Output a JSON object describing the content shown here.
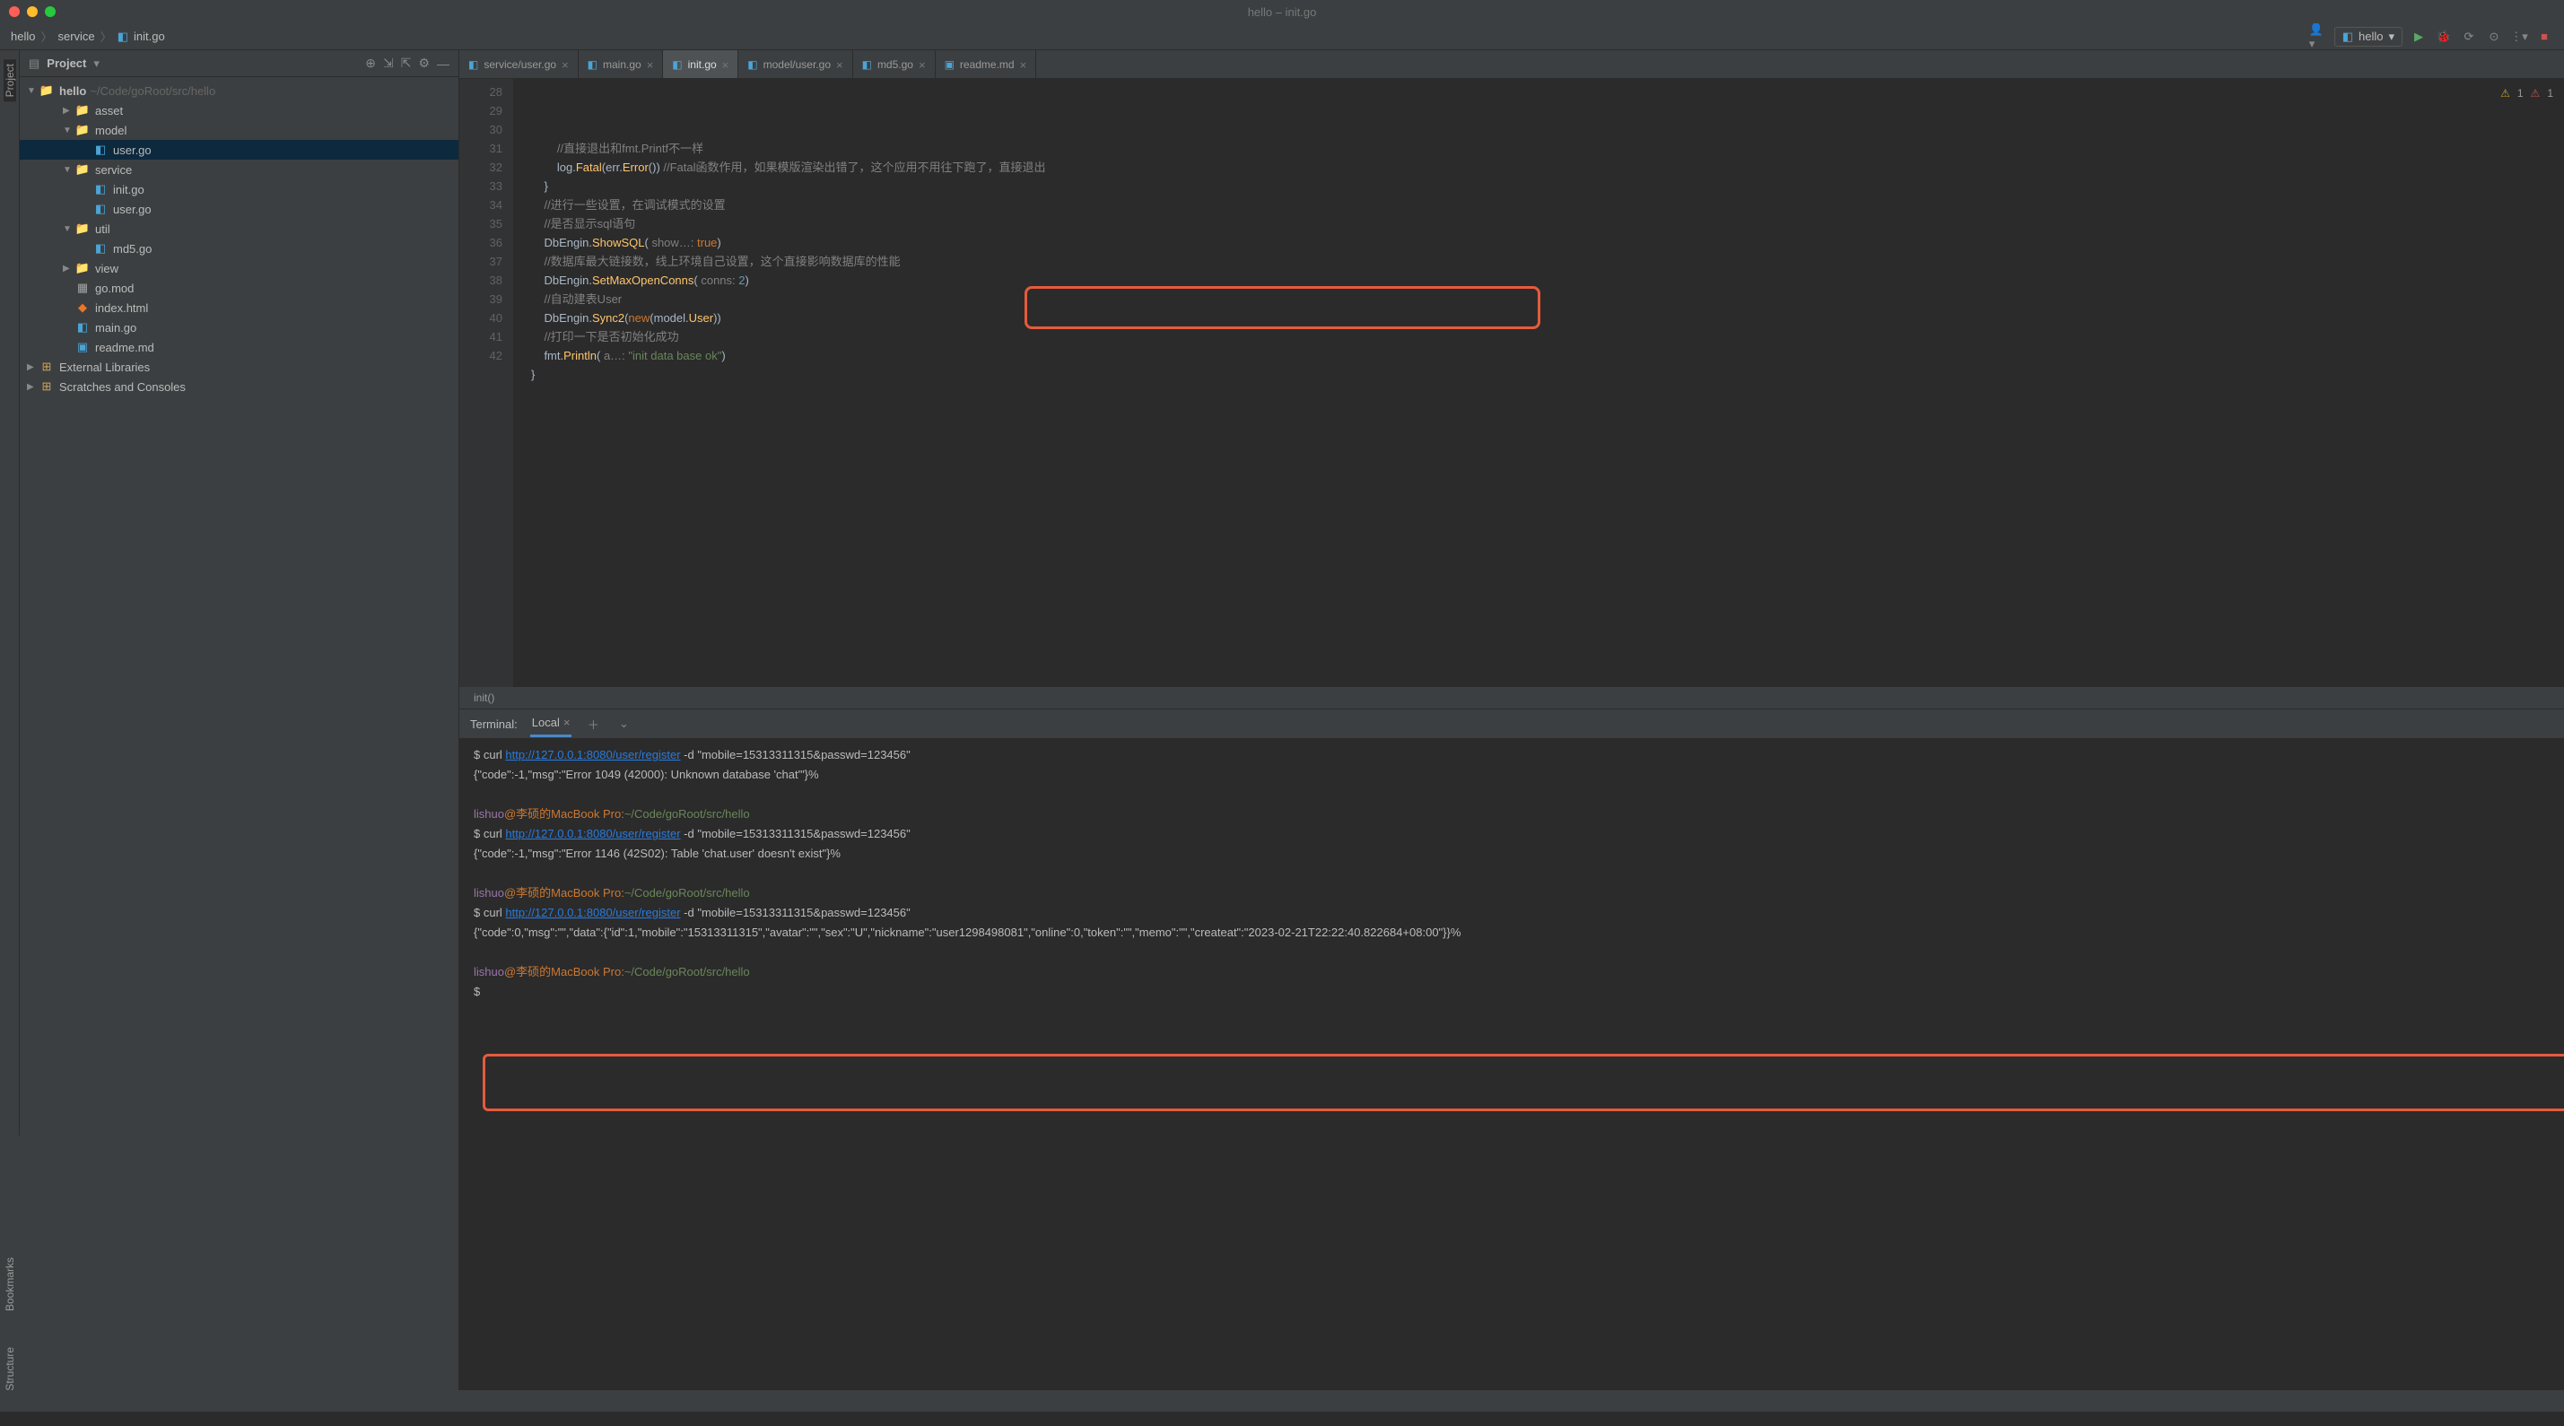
{
  "window_title": "hello – init.go",
  "breadcrumbs": [
    "hello",
    "service",
    "init.go"
  ],
  "run_config": "hello",
  "warnings": {
    "yellow": "1",
    "red": "1"
  },
  "project_header": "Project",
  "tree": {
    "root": {
      "name": "hello",
      "path": "~/Code/goRoot/src/hello"
    },
    "items": [
      {
        "name": "asset",
        "type": "folder",
        "indent": 2,
        "expand": "▶"
      },
      {
        "name": "model",
        "type": "folder",
        "indent": 2,
        "expand": "▼"
      },
      {
        "name": "user.go",
        "type": "go",
        "indent": 3,
        "selected": true
      },
      {
        "name": "service",
        "type": "folder",
        "indent": 2,
        "expand": "▼"
      },
      {
        "name": "init.go",
        "type": "go",
        "indent": 3
      },
      {
        "name": "user.go",
        "type": "go",
        "indent": 3
      },
      {
        "name": "util",
        "type": "folder",
        "indent": 2,
        "expand": "▼"
      },
      {
        "name": "md5.go",
        "type": "go",
        "indent": 3
      },
      {
        "name": "view",
        "type": "folder",
        "indent": 2,
        "expand": "▶"
      },
      {
        "name": "go.mod",
        "type": "mod",
        "indent": 2
      },
      {
        "name": "index.html",
        "type": "html",
        "indent": 2
      },
      {
        "name": "main.go",
        "type": "go",
        "indent": 2
      },
      {
        "name": "readme.md",
        "type": "md",
        "indent": 2
      }
    ],
    "extras": [
      {
        "name": "External Libraries"
      },
      {
        "name": "Scratches and Consoles"
      }
    ]
  },
  "editor_tabs": [
    {
      "label": "service/user.go",
      "icon": "go"
    },
    {
      "label": "main.go",
      "icon": "go"
    },
    {
      "label": "init.go",
      "icon": "go",
      "active": true
    },
    {
      "label": "model/user.go",
      "icon": "go"
    },
    {
      "label": "md5.go",
      "icon": "go"
    },
    {
      "label": "readme.md",
      "icon": "md"
    }
  ],
  "gutter_start": 28,
  "gutter_end": 42,
  "code_lines": [
    {
      "indent": 2,
      "tokens": [
        {
          "t": "//直接退出和fmt.Printf不一样",
          "c": "cm"
        }
      ]
    },
    {
      "indent": 2,
      "tokens": [
        {
          "t": "log",
          "c": ""
        },
        {
          "t": ".",
          "c": ""
        },
        {
          "t": "Fatal",
          "c": "fn"
        },
        {
          "t": "(err.",
          "c": ""
        },
        {
          "t": "Error",
          "c": "fn"
        },
        {
          "t": "()) ",
          "c": ""
        },
        {
          "t": "//Fatal函数作用，如果模版渲染出错了，这个应用不用往下跑了，直接退出",
          "c": "cm"
        }
      ]
    },
    {
      "indent": 1,
      "tokens": [
        {
          "t": "}",
          "c": ""
        }
      ]
    },
    {
      "indent": 0,
      "tokens": []
    },
    {
      "indent": 1,
      "tokens": [
        {
          "t": "//进行一些设置，在调试模式的设置",
          "c": "cm"
        }
      ]
    },
    {
      "indent": 1,
      "tokens": [
        {
          "t": "//是否显示sql语句",
          "c": "cm"
        }
      ]
    },
    {
      "indent": 1,
      "tokens": [
        {
          "t": "DbEngin.",
          "c": ""
        },
        {
          "t": "ShowSQL",
          "c": "fn"
        },
        {
          "t": "( ",
          "c": ""
        },
        {
          "t": "show…: ",
          "c": "cm"
        },
        {
          "t": "true",
          "c": "kw"
        },
        {
          "t": ")",
          "c": ""
        }
      ]
    },
    {
      "indent": 1,
      "tokens": [
        {
          "t": "//数据库最大链接数，线上环境自己设置，这个直接影响数据库的性能",
          "c": "cm"
        }
      ]
    },
    {
      "indent": 1,
      "tokens": [
        {
          "t": "DbEngin.",
          "c": ""
        },
        {
          "t": "SetMaxOpenConns",
          "c": "fn"
        },
        {
          "t": "( ",
          "c": ""
        },
        {
          "t": "conns: ",
          "c": "cm"
        },
        {
          "t": "2",
          "c": "num"
        },
        {
          "t": ")",
          "c": ""
        }
      ]
    },
    {
      "indent": 1,
      "tokens": [
        {
          "t": "//自动建表User",
          "c": "cm"
        }
      ]
    },
    {
      "indent": 1,
      "tokens": [
        {
          "t": "DbEngin.",
          "c": ""
        },
        {
          "t": "Sync2",
          "c": "fn"
        },
        {
          "t": "(",
          "c": ""
        },
        {
          "t": "new",
          "c": "kw"
        },
        {
          "t": "(model.",
          "c": ""
        },
        {
          "t": "User",
          "c": "fn"
        },
        {
          "t": "))",
          "c": ""
        }
      ]
    },
    {
      "indent": 1,
      "tokens": [
        {
          "t": "//打印一下是否初始化成功",
          "c": "cm"
        }
      ]
    },
    {
      "indent": 1,
      "tokens": [
        {
          "t": "fmt.",
          "c": ""
        },
        {
          "t": "Println",
          "c": "fn"
        },
        {
          "t": "( ",
          "c": ""
        },
        {
          "t": "a…: ",
          "c": "cm"
        },
        {
          "t": "\"init data base ok\"",
          "c": "str"
        },
        {
          "t": ")",
          "c": ""
        }
      ]
    },
    {
      "indent": 0,
      "tokens": [
        {
          "t": "}",
          "c": ""
        }
      ]
    },
    {
      "indent": 0,
      "tokens": []
    }
  ],
  "breadcrumb_bottom": "init()",
  "terminal": {
    "header_label": "Terminal:",
    "tab": "Local",
    "lines": [
      {
        "type": "cmd",
        "parts": [
          "$ curl ",
          {
            "url": "http://127.0.0.1:8080/user/register"
          },
          " -d \"mobile=15313311315&passwd=123456\""
        ]
      },
      {
        "type": "out",
        "text": "{\"code\":-1,\"msg\":\"Error 1049 (42000): Unknown database 'chat'\"}%"
      },
      {
        "type": "blank"
      },
      {
        "type": "prompt",
        "user": "lishuo",
        "host": "@李硕的MacBook Pro:",
        "path": "~/Code/goRoot/src/hello"
      },
      {
        "type": "cmd",
        "parts": [
          "$ curl ",
          {
            "url": "http://127.0.0.1:8080/user/register"
          },
          " -d \"mobile=15313311315&passwd=123456\""
        ]
      },
      {
        "type": "out",
        "text": "{\"code\":-1,\"msg\":\"Error 1146 (42S02): Table 'chat.user' doesn't exist\"}%"
      },
      {
        "type": "blank"
      },
      {
        "type": "prompt",
        "user": "lishuo",
        "host": "@李硕的MacBook Pro:",
        "path": "~/Code/goRoot/src/hello"
      },
      {
        "type": "cmd",
        "parts": [
          "$ curl ",
          {
            "url": "http://127.0.0.1:8080/user/register"
          },
          " -d \"mobile=15313311315&passwd=123456\""
        ]
      },
      {
        "type": "out",
        "text": "{\"code\":0,\"msg\":\"\",\"data\":{\"id\":1,\"mobile\":\"15313311315\",\"avatar\":\"\",\"sex\":\"U\",\"nickname\":\"user1298498081\",\"online\":0,\"token\":\"\",\"memo\":\"\",\"createat\":\"2023-02-21T22:22:40.822684+08:00\"}}%"
      },
      {
        "type": "blank"
      },
      {
        "type": "prompt",
        "user": "lishuo",
        "host": "@李硕的MacBook Pro:",
        "path": "~/Code/goRoot/src/hello"
      },
      {
        "type": "out",
        "text": "$ "
      }
    ]
  },
  "sidebar_left": [
    "Project"
  ],
  "sidebar_right": [],
  "sidebar_bottom_left": [
    "Bookmarks",
    "Structure"
  ]
}
